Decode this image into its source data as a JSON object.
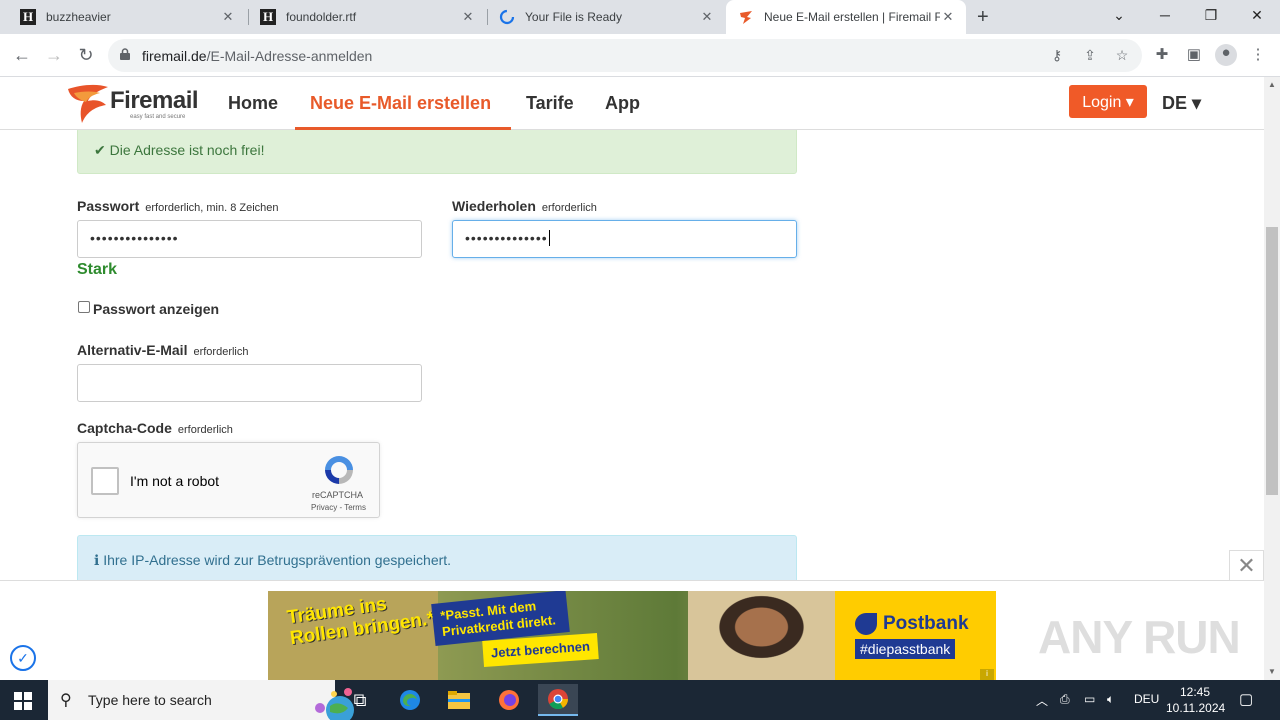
{
  "browser": {
    "tabs": [
      {
        "title": "buzzheavier",
        "icon": "h-letter-icon"
      },
      {
        "title": "foundolder.rtf",
        "icon": "h-letter-icon"
      },
      {
        "title": "Your File is Ready",
        "icon": "loading-spinner-icon"
      },
      {
        "title": "Neue E-Mail erstellen | Firemail F",
        "icon": "firemail-logo-icon",
        "active": true
      }
    ],
    "url_domain": "firemail.de",
    "url_path": "/E-Mail-Adresse-anmelden"
  },
  "site": {
    "logo_text": "Firemail",
    "logo_tagline": "easy fast and secure",
    "nav": [
      "Home",
      "Neue E-Mail erstellen",
      "Tarife",
      "App"
    ],
    "active_nav": "Neue E-Mail erstellen",
    "login_label": "Login ▾",
    "lang_label": "DE ▾",
    "accent_color": "#e85a2a"
  },
  "form": {
    "available_msg": "Die Adresse ist noch frei!",
    "password_label": "Passwort",
    "password_hint": "erforderlich, min. 8 Zeichen",
    "password_value": "•••••••••••••••",
    "repeat_label": "Wiederholen",
    "repeat_hint": "erforderlich",
    "repeat_value": "••••••••••••••",
    "strength": "Stark",
    "show_password_label": "Passwort anzeigen",
    "alt_email_label": "Alternativ-E-Mail",
    "alt_email_hint": "erforderlich",
    "alt_email_value": "",
    "captcha_label": "Captcha-Code",
    "captcha_hint": "erforderlich",
    "captcha_text": "I'm not a robot",
    "captcha_brand": "reCAPTCHA",
    "captcha_terms": "Privacy - Terms",
    "ip_notice": "Ihre IP-Adresse wird zur Betrugsprävention gespeichert."
  },
  "ad": {
    "slogan": "Träume ins Rollen bringen.*",
    "offer": "*Passt. Mit dem Privatkredit direkt.",
    "cta": "Jetzt berechnen",
    "brand": "Postbank",
    "hashtag": "#diepasstbank",
    "info": "i"
  },
  "watermark": "ANY RUN",
  "taskbar": {
    "search_placeholder": "Type here to search",
    "lang": "DEU",
    "time": "12:45",
    "date": "10.11.2024"
  }
}
